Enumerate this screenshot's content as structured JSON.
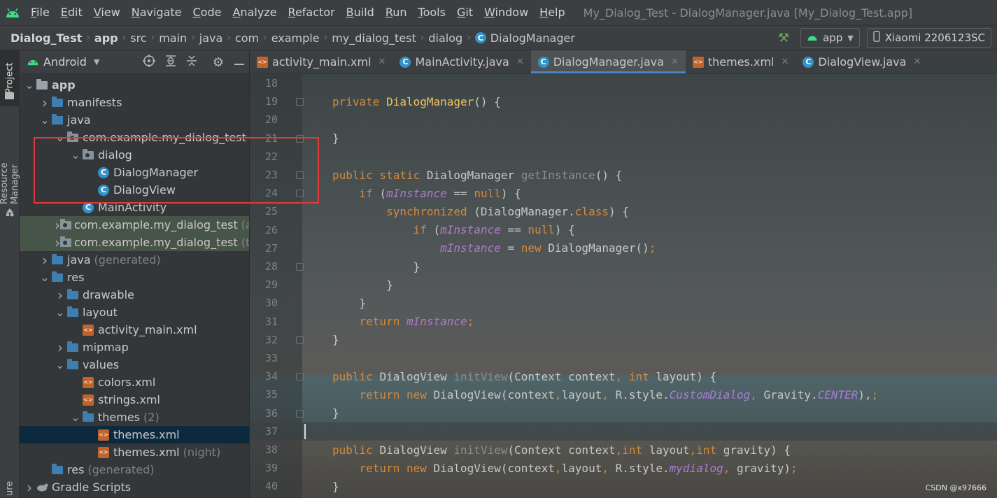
{
  "menubar": {
    "items": [
      "File",
      "Edit",
      "View",
      "Navigate",
      "Code",
      "Analyze",
      "Refactor",
      "Build",
      "Run",
      "Tools",
      "Git",
      "Window",
      "Help"
    ],
    "window_title": "My_Dialog_Test - DialogManager.java [My_Dialog_Test.app]"
  },
  "breadcrumb": [
    "Dialog_Test",
    "app",
    "src",
    "main",
    "java",
    "com",
    "example",
    "my_dialog_test",
    "dialog",
    "DialogManager"
  ],
  "toolbar": {
    "run_config": "app",
    "device": "Xiaomi 2206123SC"
  },
  "stripe": {
    "project": "Project",
    "resource_manager": "Resource Manager",
    "bottom": "ure"
  },
  "panel": {
    "view_mode": "Android"
  },
  "tree": [
    {
      "label": "app",
      "extra": "",
      "depth": 0,
      "expanded": true,
      "icon": "module-icon",
      "bold": true
    },
    {
      "label": "manifests",
      "extra": "",
      "depth": 1,
      "expanded": false,
      "icon": "folder-icon"
    },
    {
      "label": "java",
      "extra": "",
      "depth": 1,
      "expanded": true,
      "icon": "folder-icon"
    },
    {
      "label": "com.example.my_dialog_test",
      "extra": "",
      "depth": 2,
      "expanded": true,
      "icon": "package-icon"
    },
    {
      "label": "dialog",
      "extra": "",
      "depth": 3,
      "expanded": true,
      "icon": "package-icon"
    },
    {
      "label": "DialogManager",
      "extra": "",
      "depth": 4,
      "icon": "class-icon"
    },
    {
      "label": "DialogView",
      "extra": "",
      "depth": 4,
      "icon": "class-icon"
    },
    {
      "label": "MainActivity",
      "extra": "",
      "depth": 3,
      "icon": "class-icon"
    },
    {
      "label": "com.example.my_dialog_test",
      "extra": "(a",
      "depth": 2,
      "expanded": false,
      "icon": "package-icon",
      "tinted": true
    },
    {
      "label": "com.example.my_dialog_test",
      "extra": "(te",
      "depth": 2,
      "expanded": false,
      "icon": "package-icon",
      "tinted": true
    },
    {
      "label": "java",
      "extra": "(generated)",
      "depth": 1,
      "expanded": false,
      "icon": "folder-icon"
    },
    {
      "label": "res",
      "extra": "",
      "depth": 1,
      "expanded": true,
      "icon": "folder-icon"
    },
    {
      "label": "drawable",
      "extra": "",
      "depth": 2,
      "expanded": false,
      "icon": "folder-icon"
    },
    {
      "label": "layout",
      "extra": "",
      "depth": 2,
      "expanded": true,
      "icon": "folder-icon"
    },
    {
      "label": "activity_main.xml",
      "extra": "",
      "depth": 3,
      "icon": "xml-icon"
    },
    {
      "label": "mipmap",
      "extra": "",
      "depth": 2,
      "expanded": false,
      "icon": "folder-icon"
    },
    {
      "label": "values",
      "extra": "",
      "depth": 2,
      "expanded": true,
      "icon": "folder-icon"
    },
    {
      "label": "colors.xml",
      "extra": "",
      "depth": 3,
      "icon": "xml-icon"
    },
    {
      "label": "strings.xml",
      "extra": "",
      "depth": 3,
      "icon": "xml-icon"
    },
    {
      "label": "themes",
      "extra": "(2)",
      "depth": 3,
      "expanded": true,
      "icon": "folder-icon"
    },
    {
      "label": "themes.xml",
      "extra": "",
      "depth": 4,
      "icon": "xml-icon",
      "selected": true
    },
    {
      "label": "themes.xml",
      "extra": "(night)",
      "depth": 4,
      "icon": "xml-icon"
    },
    {
      "label": "res",
      "extra": "(generated)",
      "depth": 1,
      "icon": "folder-icon"
    },
    {
      "label": "Gradle Scripts",
      "extra": "",
      "depth": 0,
      "expanded": false,
      "icon": "gradle-icon"
    }
  ],
  "tabs": [
    {
      "label": "activity_main.xml",
      "icon": "xml-icon",
      "active": false
    },
    {
      "label": "MainActivity.java",
      "icon": "class-icon",
      "active": false
    },
    {
      "label": "DialogManager.java",
      "icon": "class-icon",
      "active": true
    },
    {
      "label": "themes.xml",
      "icon": "xml-icon",
      "active": false
    },
    {
      "label": "DialogView.java",
      "icon": "class-icon",
      "active": false
    }
  ],
  "editor": {
    "current_line": 37,
    "lines": [
      {
        "n": "18",
        "t": []
      },
      {
        "n": "19",
        "t": [
          [
            "kw",
            "private "
          ],
          [
            "fn",
            "DialogManager"
          ],
          [
            "",
            "() {"
          ]
        ]
      },
      {
        "n": "20",
        "t": []
      },
      {
        "n": "21",
        "t": [
          [
            "",
            "}"
          ]
        ]
      },
      {
        "n": "22",
        "t": []
      },
      {
        "n": "23",
        "t": [
          [
            "kw",
            "public static "
          ],
          [
            "",
            "DialogManager "
          ],
          [
            "fnm",
            "getInstance"
          ],
          [
            "",
            "() {"
          ]
        ]
      },
      {
        "n": "24",
        "t": [
          [
            "",
            "    "
          ],
          [
            "kw",
            "if "
          ],
          [
            "",
            "("
          ],
          [
            "fld",
            "mInstance"
          ],
          [
            "",
            " == "
          ],
          [
            "kw",
            "null"
          ],
          [
            "",
            ") {"
          ]
        ]
      },
      {
        "n": "25",
        "t": [
          [
            "",
            "        "
          ],
          [
            "kw",
            "synchronized "
          ],
          [
            "",
            "(DialogManager."
          ],
          [
            "kw",
            "class"
          ],
          [
            "",
            ") {"
          ]
        ]
      },
      {
        "n": "26",
        "t": [
          [
            "",
            "            "
          ],
          [
            "kw",
            "if "
          ],
          [
            "",
            "("
          ],
          [
            "fld",
            "mInstance"
          ],
          [
            "",
            " == "
          ],
          [
            "kw",
            "null"
          ],
          [
            "",
            ") {"
          ]
        ]
      },
      {
        "n": "27",
        "t": [
          [
            "",
            "                "
          ],
          [
            "fld",
            "mInstance"
          ],
          [
            "",
            " = "
          ],
          [
            "kw",
            "new "
          ],
          [
            "",
            "DialogManager()"
          ],
          [
            "kw",
            ";"
          ]
        ]
      },
      {
        "n": "28",
        "t": [
          [
            "",
            "            }"
          ]
        ]
      },
      {
        "n": "29",
        "t": [
          [
            "",
            "        }"
          ]
        ]
      },
      {
        "n": "30",
        "t": [
          [
            "",
            "    }"
          ]
        ]
      },
      {
        "n": "31",
        "t": [
          [
            "",
            "    "
          ],
          [
            "kw",
            "return "
          ],
          [
            "fld",
            "mInstance"
          ],
          [
            "kw",
            ";"
          ]
        ]
      },
      {
        "n": "32",
        "t": [
          [
            "",
            "}"
          ]
        ]
      },
      {
        "n": "33",
        "t": []
      },
      {
        "n": "34",
        "t": [
          [
            "kw",
            "public "
          ],
          [
            "",
            "DialogView "
          ],
          [
            "fnm",
            "initView"
          ],
          [
            "",
            "(Context context"
          ],
          [
            "kw",
            ", int "
          ],
          [
            "",
            "layout) {"
          ]
        ]
      },
      {
        "n": "35",
        "t": [
          [
            "",
            "    "
          ],
          [
            "kw",
            "return new "
          ],
          [
            "",
            "DialogView(context"
          ],
          [
            "kw",
            ","
          ],
          [
            "",
            "layout"
          ],
          [
            "kw",
            ", "
          ],
          [
            "",
            "R.style."
          ],
          [
            "cst",
            "CustomDialog"
          ],
          [
            "kw",
            ", "
          ],
          [
            "",
            "Gravity."
          ],
          [
            "cst",
            "CENTER"
          ],
          [
            "",
            "),"
          ],
          [
            "kw",
            ";"
          ]
        ]
      },
      {
        "n": "36",
        "t": [
          [
            "",
            "}"
          ]
        ]
      },
      {
        "n": "37",
        "t": []
      },
      {
        "n": "38",
        "t": [
          [
            "kw",
            "public "
          ],
          [
            "",
            "DialogView "
          ],
          [
            "fnm",
            "initView"
          ],
          [
            "",
            "(Context context"
          ],
          [
            "kw",
            ",int "
          ],
          [
            "",
            "layout"
          ],
          [
            "kw",
            ",int "
          ],
          [
            "",
            "gravity) {"
          ]
        ]
      },
      {
        "n": "39",
        "t": [
          [
            "",
            "    "
          ],
          [
            "kw",
            "return new "
          ],
          [
            "",
            "DialogView(context"
          ],
          [
            "kw",
            ","
          ],
          [
            "",
            "layout"
          ],
          [
            "kw",
            ", "
          ],
          [
            "",
            "R.style."
          ],
          [
            "cst",
            "mydialog"
          ],
          [
            "kw",
            ", "
          ],
          [
            "",
            "gravity)"
          ],
          [
            "kw",
            ";"
          ]
        ]
      },
      {
        "n": "40",
        "t": [
          [
            "",
            "}"
          ]
        ]
      }
    ]
  },
  "watermark": "CSDN @x97666",
  "colors": {
    "accent": "#4a88c7",
    "keyword": "#d48a3a",
    "field": "#b07ac9",
    "highlight_box": "#e03a3a",
    "android_green": "#3ddc84"
  }
}
